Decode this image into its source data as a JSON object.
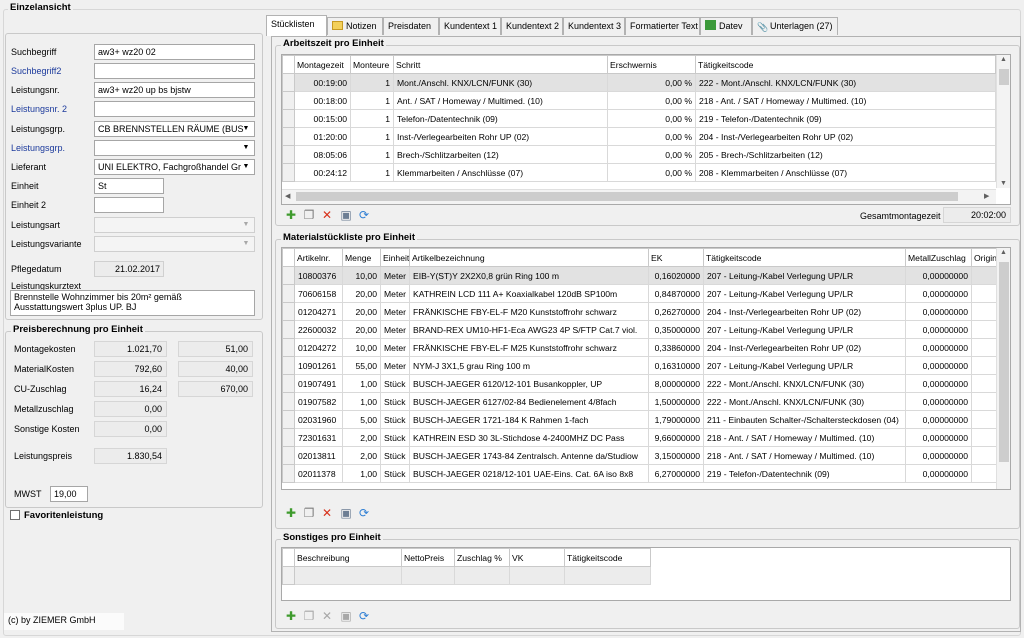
{
  "window_title": "Einzelansicht",
  "left": {
    "fields": [
      {
        "label": "Suchbegriff",
        "value": "aw3+ wz20 02",
        "blue": false
      },
      {
        "label": "Suchbegriff2",
        "value": "",
        "blue": true
      },
      {
        "label": "Leistungsnr.",
        "value": "aw3+ wz20 up bs bjstw",
        "blue": false
      },
      {
        "label": "Leistungsnr. 2",
        "value": "",
        "blue": true
      },
      {
        "label": "Leistungsgrp.",
        "value": "CB BRENNSTELLEN RÄUME (BUS",
        "blue": false
      },
      {
        "label": "Leistungsgrp.",
        "value": "",
        "blue": true
      },
      {
        "label": "Lieferant",
        "value": "UNI ELEKTRO, Fachgroßhandel Gr",
        "blue": false
      },
      {
        "label": "Einheit",
        "value": "St",
        "blue": false
      },
      {
        "label": "Einheit 2",
        "value": "",
        "blue": false
      },
      {
        "label": "Leistungsart",
        "value": "",
        "blue": false
      },
      {
        "label": "Leistungsvariante",
        "value": "",
        "blue": false
      }
    ],
    "pflegedatum_label": "Pflegedatum",
    "pflegedatum_value": "21.02.2017",
    "kurztext_label": "Leistungskurztext",
    "kurztext_line1": "Brennstelle Wohnzimmer bis 20m² gemäß",
    "kurztext_line2": "Ausstattungswert 3plus UP. BJ",
    "preis": {
      "title": "Preisberechnung pro Einheit",
      "montage_label": "Montagekosten",
      "montage_value": "1.021,70",
      "montage_value2": "51,00",
      "material_label": "MaterialKosten",
      "material_value": "792,60",
      "material_value2": "40,00",
      "cu_label": "CU-Zuschlag",
      "cu_value": "16,24",
      "cu_value2": "670,00",
      "metall_label": "Metallzuschlag",
      "metall_value": "0,00",
      "sonstige_label": "Sonstige Kosten",
      "sonstige_value": "0,00",
      "leistungspreis_label": "Leistungspreis",
      "leistungspreis_value": "1.830,54",
      "mwst_label": "MWST",
      "mwst_value": "19,00"
    },
    "favoriten_label": "Favoritenleistung",
    "copyright": "(c) by ZIEMER GmbH"
  },
  "tabs": [
    {
      "label": "Stücklisten",
      "active": true,
      "icon": ""
    },
    {
      "label": "Notizen",
      "active": false,
      "icon": "folder-icon"
    },
    {
      "label": "Preisdaten",
      "active": false,
      "icon": ""
    },
    {
      "label": "Kundentext 1",
      "active": false,
      "icon": ""
    },
    {
      "label": "Kundentext 2",
      "active": false,
      "icon": ""
    },
    {
      "label": "Kundentext 3",
      "active": false,
      "icon": ""
    },
    {
      "label": "Formatierter Text",
      "active": false,
      "icon": ""
    },
    {
      "label": "Datev",
      "active": false,
      "icon": "datev-icon"
    },
    {
      "label": "Unterlagen (27)",
      "active": false,
      "icon": "paperclip-icon"
    }
  ],
  "arbeitszeit": {
    "title": "Arbeitszeit pro Einheit",
    "columns": [
      "Montagezeit",
      "Monteure",
      "Schritt",
      "Erschwernis",
      "Tätigkeitscode"
    ],
    "rows": [
      [
        "00:19:00",
        "1",
        "Mont./Anschl. KNX/LCN/FUNK (30)",
        "0,00 %",
        "222 - Mont./Anschl. KNX/LCN/FUNK (30)"
      ],
      [
        "00:18:00",
        "1",
        "Ant. / SAT / Homeway / Multimed. (10)",
        "0,00 %",
        "218 - Ant. / SAT / Homeway / Multimed. (10)"
      ],
      [
        "00:15:00",
        "1",
        "Telefon-/Datentechnik (09)",
        "0,00 %",
        "219 - Telefon-/Datentechnik (09)"
      ],
      [
        "01:20:00",
        "1",
        "Inst-/Verlegearbeiten Rohr UP (02)",
        "0,00 %",
        "204 - Inst-/Verlegearbeiten Rohr UP (02)"
      ],
      [
        "08:05:06",
        "1",
        "Brech-/Schlitzarbeiten (12)",
        "0,00 %",
        "205 - Brech-/Schlitzarbeiten (12)"
      ],
      [
        "00:24:12",
        "1",
        "Klemmarbeiten / Anschlüsse (07)",
        "0,00 %",
        "208 - Klemmarbeiten / Anschlüsse (07)"
      ]
    ],
    "gesamt_label": "Gesamtmontagezeit",
    "gesamt_value": "20:02:00"
  },
  "material": {
    "title": "Materialstückliste pro Einheit",
    "columns": [
      "Artikelnr.",
      "Menge",
      "Einheit",
      "Artikelbezeichnung",
      "EK",
      "Tätigkeitscode",
      "MetallZuschlag",
      "Origin"
    ],
    "rows": [
      [
        "10800376",
        "10,00",
        "Meter",
        "EIB-Y(ST)Y 2X2X0,8 grün Ring 100 m",
        "0,16020000",
        "207 - Leitung-/Kabel Verlegung UP/LR",
        "0,00000000"
      ],
      [
        "70606158",
        "20,00",
        "Meter",
        "KATHREIN LCD 111 A+ Koaxialkabel 120dB SP100m",
        "0,84870000",
        "207 - Leitung-/Kabel Verlegung UP/LR",
        "0,00000000"
      ],
      [
        "01204271",
        "20,00",
        "Meter",
        "FRÄNKISCHE FBY-EL-F M20 Kunststoffrohr schwarz",
        "0,26270000",
        "204 - Inst-/Verlegearbeiten Rohr UP (02)",
        "0,00000000"
      ],
      [
        "22600032",
        "20,00",
        "Meter",
        "BRAND-REX UM10-HF1-Eca AWG23 4P S/FTP Cat.7 viol.",
        "0,35000000",
        "207 - Leitung-/Kabel Verlegung UP/LR",
        "0,00000000"
      ],
      [
        "01204272",
        "10,00",
        "Meter",
        "FRÄNKISCHE FBY-EL-F M25 Kunststoffrohr schwarz",
        "0,33860000",
        "204 - Inst-/Verlegearbeiten Rohr UP (02)",
        "0,00000000"
      ],
      [
        "10901261",
        "55,00",
        "Meter",
        "NYM-J 3X1,5 grau Ring 100 m",
        "0,16310000",
        "207 - Leitung-/Kabel Verlegung UP/LR",
        "0,00000000"
      ],
      [
        "01907491",
        "1,00",
        "Stück",
        "BUSCH-JAEGER 6120/12-101 Busankoppler, UP",
        "8,00000000",
        "222 - Mont./Anschl. KNX/LCN/FUNK (30)",
        "0,00000000"
      ],
      [
        "01907582",
        "1,00",
        "Stück",
        "BUSCH-JAEGER 6127/02-84 Bedienelement 4/8fach",
        "1,50000000",
        "222 - Mont./Anschl. KNX/LCN/FUNK (30)",
        "0,00000000"
      ],
      [
        "02031960",
        "5,00",
        "Stück",
        "BUSCH-JAEGER 1721-184 K Rahmen 1-fach",
        "1,79000000",
        "211 - Einbauten Schalter-/Schaltersteckdosen (04)",
        "0,00000000"
      ],
      [
        "72301631",
        "2,00",
        "Stück",
        "KATHREIN ESD 30 3L-Stichdose 4-2400MHZ DC Pass",
        "9,66000000",
        "218 - Ant. / SAT / Homeway / Multimed. (10)",
        "0,00000000"
      ],
      [
        "02013811",
        "2,00",
        "Stück",
        "BUSCH-JAEGER 1743-84 Zentralsch. Antenne da/Studiow",
        "3,15000000",
        "218 - Ant. / SAT / Homeway / Multimed. (10)",
        "0,00000000"
      ],
      [
        "02011378",
        "1,00",
        "Stück",
        "BUSCH-JAEGER 0218/12-101 UAE-Eins. Cat. 6A iso 8x8",
        "6,27000000",
        "219 - Telefon-/Datentechnik (09)",
        "0,00000000"
      ]
    ]
  },
  "sonstiges": {
    "title": "Sonstiges pro Einheit",
    "columns": [
      "Beschreibung",
      "NettoPreis",
      "Zuschlag %",
      "VK",
      "Tätigkeitscode"
    ]
  }
}
